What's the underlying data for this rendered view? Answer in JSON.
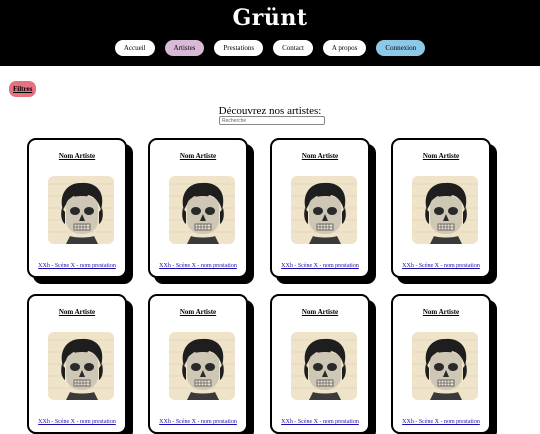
{
  "brand": {
    "logo": "Grünt"
  },
  "nav": {
    "items": [
      {
        "label": "Accueil"
      },
      {
        "label": "Artistes"
      },
      {
        "label": "Prestations"
      },
      {
        "label": "Contact"
      },
      {
        "label": "A propos"
      },
      {
        "label": "Connexion"
      }
    ]
  },
  "filters": {
    "label": "Filtres"
  },
  "discover": {
    "title": "Découvrez nos artistes:"
  },
  "search": {
    "placeholder": "Recherche"
  },
  "colors": {
    "header_bg": "#000000",
    "active_nav": "#d9bad6",
    "login": "#8cc8e8",
    "filters": "#e8717f",
    "link": "#1a0dab"
  },
  "cards": [
    {
      "name": "Nom Artiste",
      "link": "XXh - Scène X - nom prestation",
      "image": "skull-portrait-icon"
    },
    {
      "name": "Nom Artiste",
      "link": "XXh - Scène X - nom prestation",
      "image": "skull-portrait-icon"
    },
    {
      "name": "Nom Artiste",
      "link": "XXh - Scène X - nom prestation",
      "image": "skull-portrait-icon"
    },
    {
      "name": "Nom Artiste",
      "link": "XXh - Scène X - nom prestation",
      "image": "skull-portrait-icon"
    },
    {
      "name": "Nom Artiste",
      "link": "XXh - Scène X - nom prestation",
      "image": "skull-portrait-icon"
    },
    {
      "name": "Nom Artiste",
      "link": "XXh - Scène X - nom prestation",
      "image": "skull-portrait-icon"
    },
    {
      "name": "Nom Artiste",
      "link": "XXh - Scène X - nom prestation",
      "image": "skull-portrait-icon"
    },
    {
      "name": "Nom Artiste",
      "link": "XXh - Scène X - nom prestation",
      "image": "skull-portrait-icon"
    }
  ]
}
